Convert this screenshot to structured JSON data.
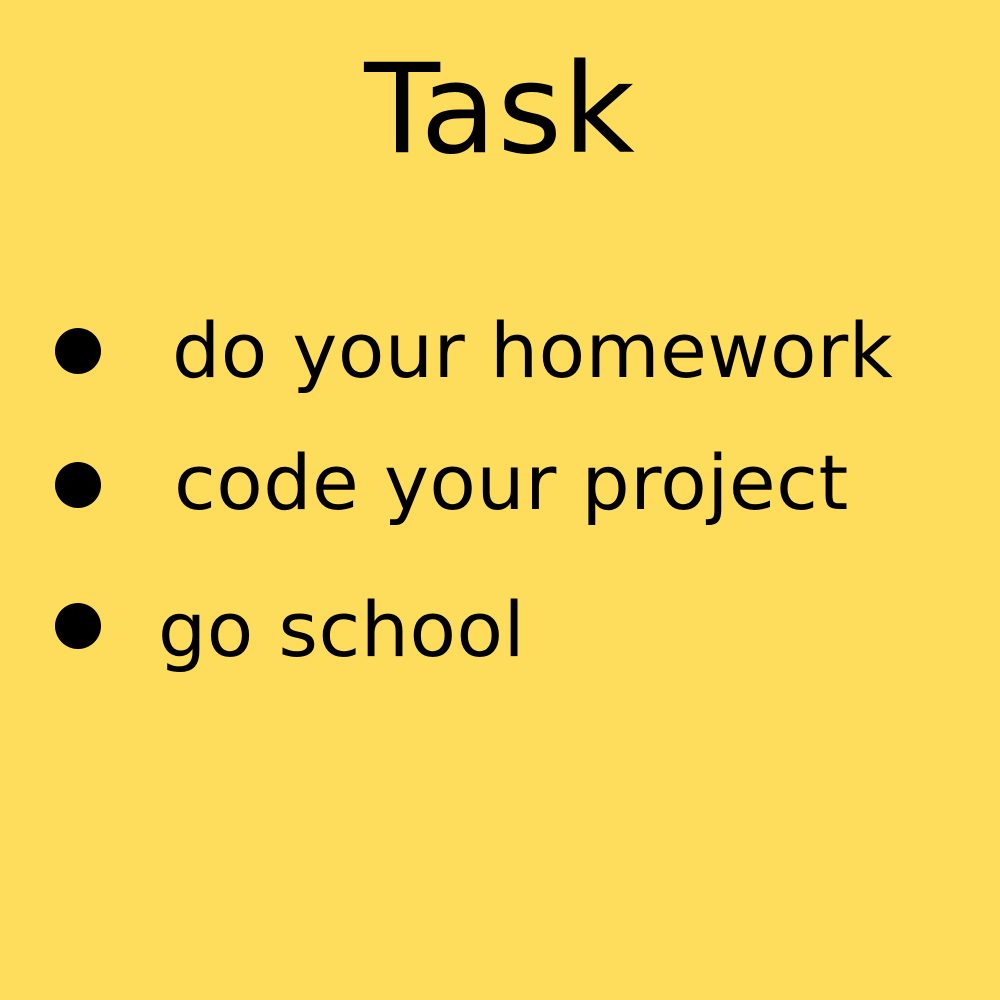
{
  "title": "Task",
  "tasks": [
    {
      "label": "do your homework"
    },
    {
      "label": "code your project"
    },
    {
      "label": "go school"
    }
  ],
  "colors": {
    "background": "#FFDD5C",
    "text": "#000000",
    "bullet": "#000000"
  },
  "icons": {
    "bullet": "bullet-dot-icon"
  }
}
